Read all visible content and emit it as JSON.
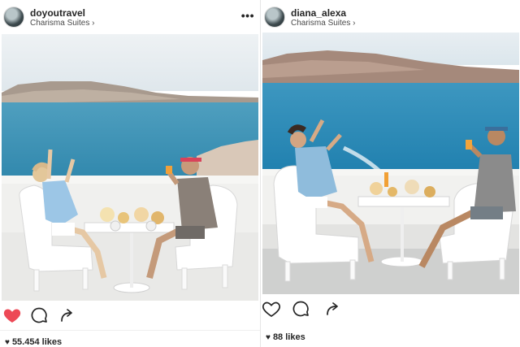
{
  "posts": [
    {
      "username": "doyoutravel",
      "location": "Charisma Suites",
      "more_icon": "ellipsis-icon",
      "likes": "55.454 likes",
      "liked": true,
      "like_color": "#ed4956"
    },
    {
      "username": "diana_alexa",
      "location": "Charisma Suites",
      "likes": "88 likes",
      "liked": false
    }
  ],
  "icons": {
    "location_chevron": "›",
    "likes_heart": "♥",
    "more": "•••"
  }
}
